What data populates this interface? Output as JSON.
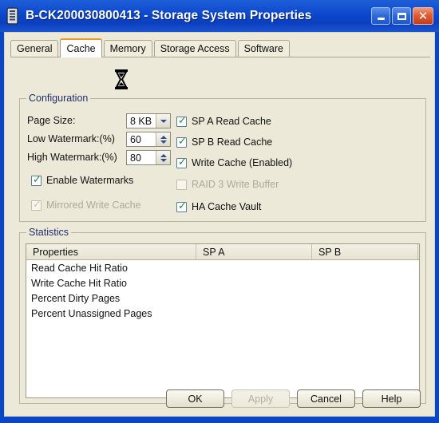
{
  "window": {
    "title": "B-CK200030800413 - Storage System Properties",
    "icon": "storage-array-icon",
    "caption_buttons": {
      "minimize": "_",
      "maximize": "□",
      "close": "✕"
    },
    "accent_titlebar": "#0d47ce",
    "dialog_background": "#ece9d8",
    "selected_tab_accent": "#ee9a2b"
  },
  "tabs": [
    {
      "label": "General",
      "selected": false
    },
    {
      "label": "Cache",
      "selected": true
    },
    {
      "label": "Memory",
      "selected": false
    },
    {
      "label": "Storage Access",
      "selected": false
    },
    {
      "label": "Software",
      "selected": false
    }
  ],
  "cursor": {
    "type": "hourglass-cursor",
    "over": "Memory"
  },
  "configuration": {
    "legend": "Configuration",
    "fields": [
      {
        "label": "Page Size:",
        "value": "8 KB",
        "control": "dropdown"
      },
      {
        "label": "Low Watermark:(%)",
        "value": "60",
        "control": "spinner"
      },
      {
        "label": "High Watermark:(%)",
        "value": "80",
        "control": "spinner"
      }
    ],
    "left_checkboxes": [
      {
        "label": "Enable Watermarks",
        "checked": true,
        "disabled": false
      },
      {
        "label": "Mirrored Write Cache",
        "checked": true,
        "disabled": true
      }
    ],
    "right_checkboxes": [
      {
        "label": "SP A Read Cache",
        "checked": true,
        "disabled": false
      },
      {
        "label": "SP B Read Cache",
        "checked": true,
        "disabled": false
      },
      {
        "label": "Write Cache (Enabled)",
        "checked": true,
        "disabled": false
      },
      {
        "label": "RAID 3 Write Buffer",
        "checked": false,
        "disabled": true
      },
      {
        "label": "HA Cache Vault",
        "checked": true,
        "disabled": false
      }
    ]
  },
  "statistics": {
    "legend": "Statistics",
    "columns": [
      "Properties",
      "SP A",
      "SP B"
    ],
    "rows": [
      {
        "property": "Read Cache Hit Ratio",
        "sp_a": "",
        "sp_b": ""
      },
      {
        "property": "Write Cache Hit Ratio",
        "sp_a": "",
        "sp_b": ""
      },
      {
        "property": "Percent Dirty Pages",
        "sp_a": "",
        "sp_b": ""
      },
      {
        "property": "Percent Unassigned Pages",
        "sp_a": "",
        "sp_b": ""
      }
    ]
  },
  "buttons": [
    {
      "label": "OK",
      "disabled": false
    },
    {
      "label": "Apply",
      "disabled": true
    },
    {
      "label": "Cancel",
      "disabled": false
    },
    {
      "label": "Help",
      "disabled": false
    }
  ]
}
